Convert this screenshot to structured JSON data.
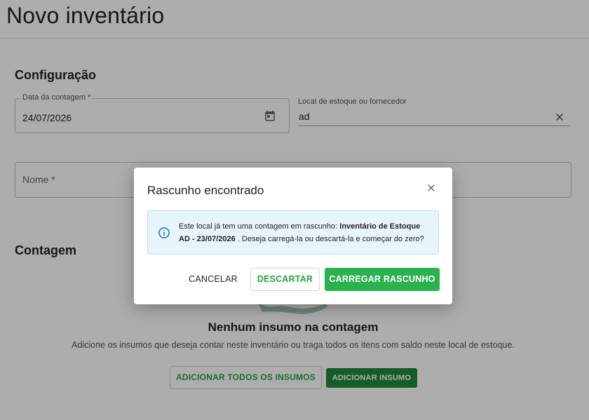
{
  "page": {
    "title": "Novo inventário"
  },
  "config": {
    "title": "Configuração",
    "date_label": "Data da contagem *",
    "date_value": "24/07/2026",
    "local_label": "Local de estoque ou fornecedor",
    "local_value": "ad",
    "nome_label": "Nome *"
  },
  "counting": {
    "title": "Contagem",
    "empty_title": "Nenhum insumo na contagem",
    "empty_desc": "Adicione os insumos que deseja contar neste inventário ou traga todos os itens com saldo neste local de estoque.",
    "add_all_label": "ADICIONAR TODOS OS INSUMOS",
    "add_one_label": "ADICIONAR INSUMO"
  },
  "dialog": {
    "title": "Rascunho encontrado",
    "alert_prefix": "Este local já tem uma contagem em rascunho: ",
    "alert_draft_name": "Inventário de Estoque AD - 23/07/2026",
    "alert_suffix": " . Deseja carregá-la ou descartá-la e começar do zero?",
    "cancel_label": "CANCELAR",
    "discard_label": "DESCARTAR",
    "load_label": "CARREGAR RASCUNHO"
  },
  "icons": {
    "calendar": "calendar-icon",
    "clear": "close-icon",
    "dialog_close": "close-icon",
    "info": "info-icon"
  },
  "colors": {
    "primary_green": "#2bb24f",
    "dark_green": "#1f8a3a",
    "info_bg": "#e8f4fc",
    "info_icon": "#1976d2"
  }
}
